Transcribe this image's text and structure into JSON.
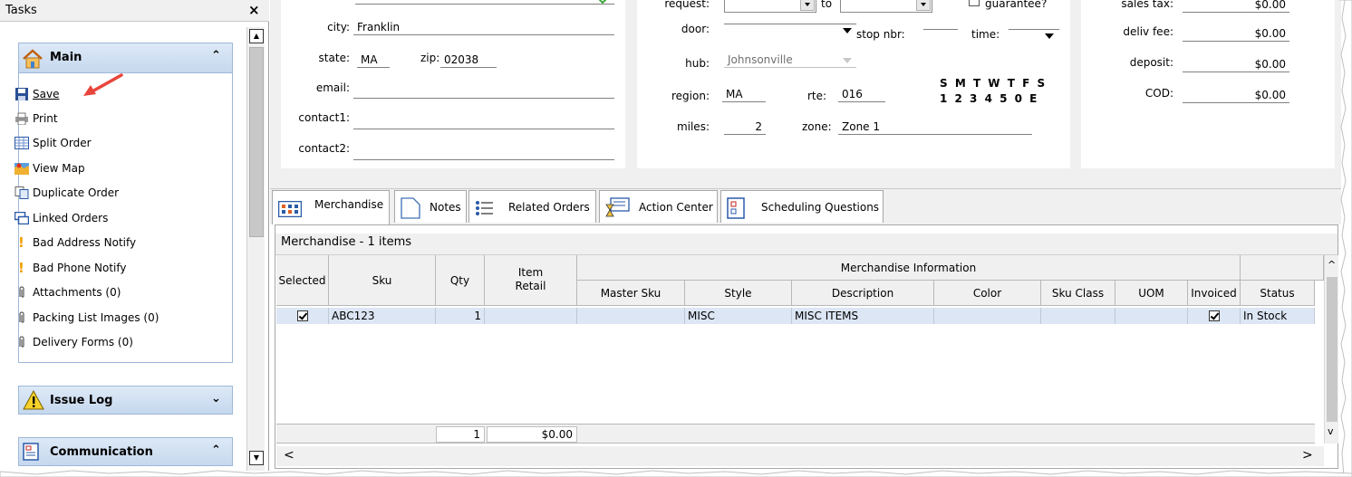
{
  "tasks_panel": {
    "title": "Tasks",
    "close_glyph": "×",
    "main_group": {
      "title": "Main",
      "collapse_glyph": "⌃",
      "items": [
        {
          "label": "Save",
          "icon": "save-icon"
        },
        {
          "label": "Print",
          "icon": "print-icon"
        },
        {
          "label": "Split Order",
          "icon": "split-order-icon"
        },
        {
          "label": "View Map",
          "icon": "map-icon"
        },
        {
          "label": "Duplicate Order",
          "icon": "duplicate-icon"
        },
        {
          "label": "Linked Orders",
          "icon": "linked-orders-icon"
        },
        {
          "label": "Bad Address Notify",
          "icon": "warning-exclamation-icon"
        },
        {
          "label": "Bad Phone Notify",
          "icon": "warning-exclamation-icon"
        },
        {
          "label": "Attachments (0)",
          "icon": "paperclip-icon"
        },
        {
          "label": "Packing List Images (0)",
          "icon": "paperclip-icon"
        },
        {
          "label": "Delivery Forms (0)",
          "icon": "paperclip-icon"
        }
      ]
    },
    "issue_log": {
      "title": "Issue Log",
      "expand_glyph": "⌄"
    },
    "communication": {
      "title": "Communication",
      "collapse_glyph": "⌃"
    }
  },
  "address": {
    "city_label": "city:",
    "city": "Franklin",
    "state_label": "state:",
    "state": "MA",
    "zip_label": "zip:",
    "zip": "02038",
    "email_label": "email:",
    "email": "",
    "contact1_label": "contact1:",
    "contact1": "",
    "contact2_label": "contact2:",
    "contact2": ""
  },
  "routing": {
    "request_label": "request:",
    "to_label": "to",
    "guarantee_label": "guarantee?",
    "door_label": "door:",
    "door": "",
    "stop_nbr_label": "stop nbr:",
    "stop_nbr": "",
    "time_label": "time:",
    "time": "",
    "hub_label": "hub:",
    "hub": "Johnsonville",
    "region_label": "region:",
    "region": "MA",
    "rte_label": "rte:",
    "rte": "016",
    "days_letters": "S M T W T F S",
    "days_numbers": "1 2 3 4 5 0 E",
    "miles_label": "miles:",
    "miles": "2",
    "zone_label": "zone:",
    "zone": "Zone 1"
  },
  "fees": {
    "sales_tax_label": "sales tax:",
    "sales_tax": "$0.00",
    "deliv_fee_label": "deliv fee:",
    "deliv_fee": "$0.00",
    "deposit_label": "deposit:",
    "deposit": "$0.00",
    "cod_label": "COD:",
    "cod": "$0.00"
  },
  "tabs": [
    {
      "label": "Merchandise",
      "icon": "merchandise-grid-icon"
    },
    {
      "label": "Notes",
      "icon": "notes-page-icon"
    },
    {
      "label": "Related Orders",
      "icon": "related-orders-list-icon"
    },
    {
      "label": "Action Center",
      "icon": "action-center-hourglass-icon"
    },
    {
      "label": "Scheduling Questions",
      "icon": "scheduling-questions-icon"
    }
  ],
  "merch": {
    "caption": "Merchandise - 1 items",
    "group_header": "Merchandise Information",
    "columns": {
      "selected": "Selected",
      "sku": "Sku",
      "qty": "Qty",
      "item_retail": "Item Retail",
      "master_sku": "Master Sku",
      "style": "Style",
      "description": "Description",
      "color": "Color",
      "sku_class": "Sku Class",
      "uom": "UOM",
      "invoiced": "Invoiced",
      "status": "Status"
    },
    "rows": [
      {
        "selected": true,
        "sku": "ABC123",
        "qty": "1",
        "item_retail": "",
        "master_sku": "",
        "style": "MISC",
        "description": "MISC ITEMS",
        "color": "",
        "sku_class": "",
        "uom": "",
        "invoiced": true,
        "status": "In Stock"
      }
    ],
    "totals": {
      "qty": "1",
      "retail": "$0.00"
    }
  },
  "scroll_glyphs": {
    "up": "▲",
    "down": "▼",
    "left": "<",
    "right": ">",
    "up_caret": "^",
    "down_caret": "v"
  }
}
